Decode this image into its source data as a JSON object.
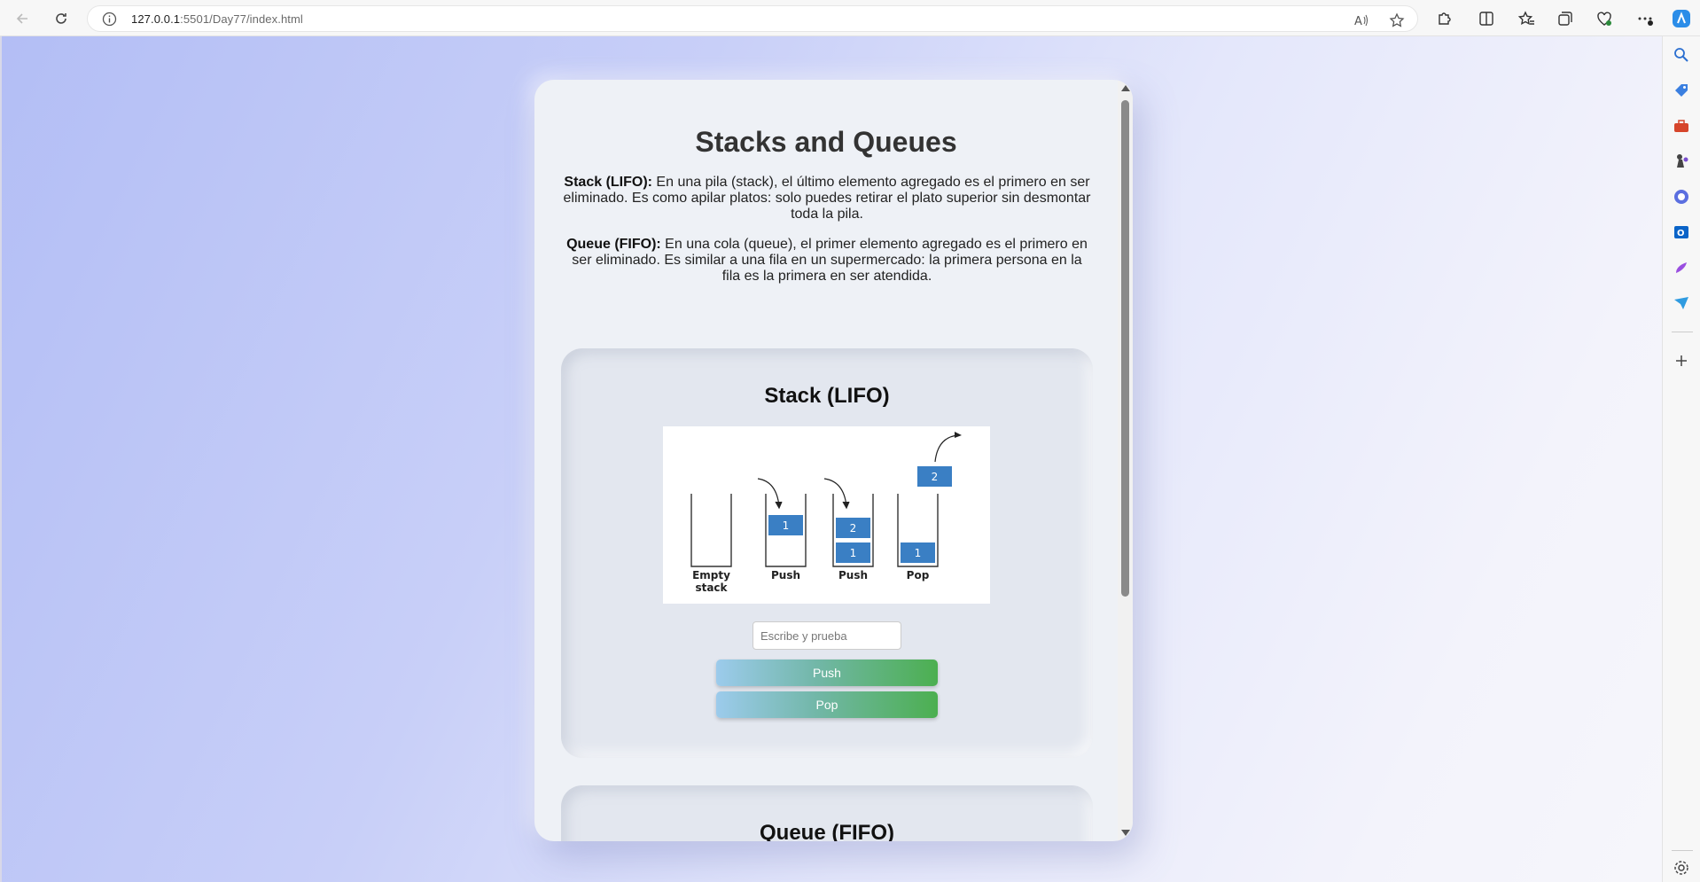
{
  "browser": {
    "url_host": "127.0.0.1",
    "url_rest": ":5501/Day77/index.html",
    "icons": {
      "back": "back-arrow-icon",
      "refresh": "refresh-icon",
      "info": "info-icon",
      "read_aloud": "read-aloud-icon",
      "favorite": "star-icon",
      "extensions": "puzzle-icon",
      "split": "split-screen-icon",
      "favorites": "favorites-icon",
      "collections": "collections-icon",
      "performance": "heart-pulse-icon",
      "more": "more-dots-icon",
      "copilot": "copilot-icon"
    },
    "sidebar_icons": [
      "search-icon",
      "tag-icon",
      "toolbox-icon",
      "chess-icon",
      "office-icon",
      "outlook-icon",
      "designer-icon",
      "send-icon",
      "add-icon",
      "settings-icon"
    ]
  },
  "page": {
    "title": "Stacks and Queues",
    "stack_desc_label": "Stack (LIFO):",
    "stack_desc_text": " En una pila (stack), el último elemento agregado es el primero en ser eliminado. Es como apilar platos: solo puedes retirar el plato superior sin desmontar toda la pila.",
    "queue_desc_label": "Queue (FIFO):",
    "queue_desc_text": " En una cola (queue), el primer elemento agregado es el primero en ser eliminado. Es similar a una fila en un supermercado: la primera persona en la fila es la primera en ser atendida."
  },
  "stack_panel": {
    "heading": "Stack (LIFO)",
    "diagram": {
      "labels": [
        "Empty",
        "stack",
        "Push",
        "Push",
        "Pop"
      ],
      "blocks": [
        "1",
        "2",
        "1",
        "1",
        "2"
      ]
    },
    "input_placeholder": "Escribe y prueba",
    "push_label": "Push",
    "pop_label": "Pop"
  },
  "queue_panel": {
    "heading": "Queue (FIFO)"
  },
  "colors": {
    "block_blue": "#3a7fc4",
    "button_gradient_start": "#9ccbec",
    "button_gradient_end": "#4caf50"
  }
}
